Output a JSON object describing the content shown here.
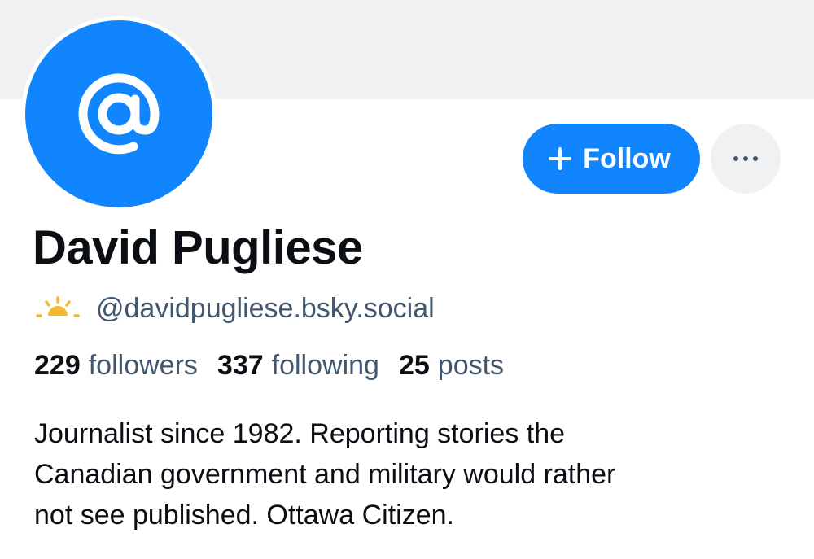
{
  "profile": {
    "display_name": "David Pugliese",
    "handle": "@davidpugliese.bsky.social",
    "bio_lines": [
      "Journalist since 1982. Reporting stories the",
      "Canadian government and military would rather",
      "not see published. Ottawa Citizen."
    ],
    "avatar_icon": "at-sign-icon",
    "handle_badge_icon": "sunrise-icon"
  },
  "stats": [
    {
      "count": "229",
      "label": "followers"
    },
    {
      "count": "337",
      "label": "following"
    },
    {
      "count": "25",
      "label": "posts"
    }
  ],
  "actions": {
    "follow_label": "Follow",
    "follow_icon": "plus-icon",
    "more_icon": "ellipsis-icon"
  },
  "colors": {
    "accent": "#1185fe",
    "banner": "#eff1f3",
    "text_primary": "#0b0f14",
    "text_secondary": "#42576c",
    "badge_sun": "#f5b82e"
  }
}
